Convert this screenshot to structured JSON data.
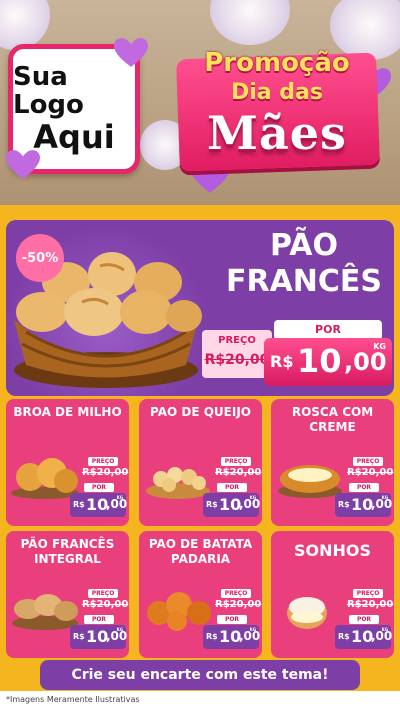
{
  "logo": {
    "line1": "Sua Logo",
    "line2": "Aqui"
  },
  "promo": {
    "line1": "Promoção",
    "line2": "Dia das",
    "line3": "Mães"
  },
  "hero": {
    "discount": "-50%",
    "title_line1": "PÃO",
    "title_line2": "FRANCÊS",
    "old_label": "PREÇO",
    "old_price": "R$20,00",
    "new_label": "POR",
    "currency": "R$",
    "price_int": "10",
    "price_cents": ",00",
    "unit": "KG"
  },
  "products": [
    {
      "title": "BROA DE MILHO",
      "old_label": "PREÇO",
      "old_price": "R$20,00",
      "new_label": "POR",
      "currency": "R$",
      "price_int": "10",
      "price_cents": ",00",
      "unit": "KG"
    },
    {
      "title": "PAO DE QUEIJO",
      "old_label": "PREÇO",
      "old_price": "R$20,00",
      "new_label": "POR",
      "currency": "R$",
      "price_int": "10",
      "price_cents": ",00",
      "unit": "KG"
    },
    {
      "title": "ROSCA COM CREME",
      "old_label": "PREÇO",
      "old_price": "R$20,00",
      "new_label": "POR",
      "currency": "R$",
      "price_int": "10",
      "price_cents": ",00",
      "unit": "KG"
    },
    {
      "title": "PÃO FRANCÊS INTEGRAL",
      "old_label": "PREÇO",
      "old_price": "R$20,00",
      "new_label": "POR",
      "currency": "R$",
      "price_int": "10",
      "price_cents": ",00",
      "unit": "KG"
    },
    {
      "title": "PAO DE BATATA PADARIA",
      "old_label": "PREÇO",
      "old_price": "R$20,00",
      "new_label": "POR",
      "currency": "R$",
      "price_int": "10",
      "price_cents": ",00",
      "unit": "KG"
    },
    {
      "title": "SONHOS",
      "old_label": "PREÇO",
      "old_price": "R$20,00",
      "new_label": "POR",
      "currency": "R$",
      "price_int": "10",
      "price_cents": ",00",
      "unit": "KG"
    }
  ],
  "cta": "Crie seu encarte com este tema!",
  "disclaimer": "*Imagens Meramente Ilustrativas",
  "colors": {
    "pink": "#ea3f7d",
    "purple": "#7d3fa6",
    "yellow": "#f5b51e",
    "light_pink": "#ffd7e6"
  }
}
